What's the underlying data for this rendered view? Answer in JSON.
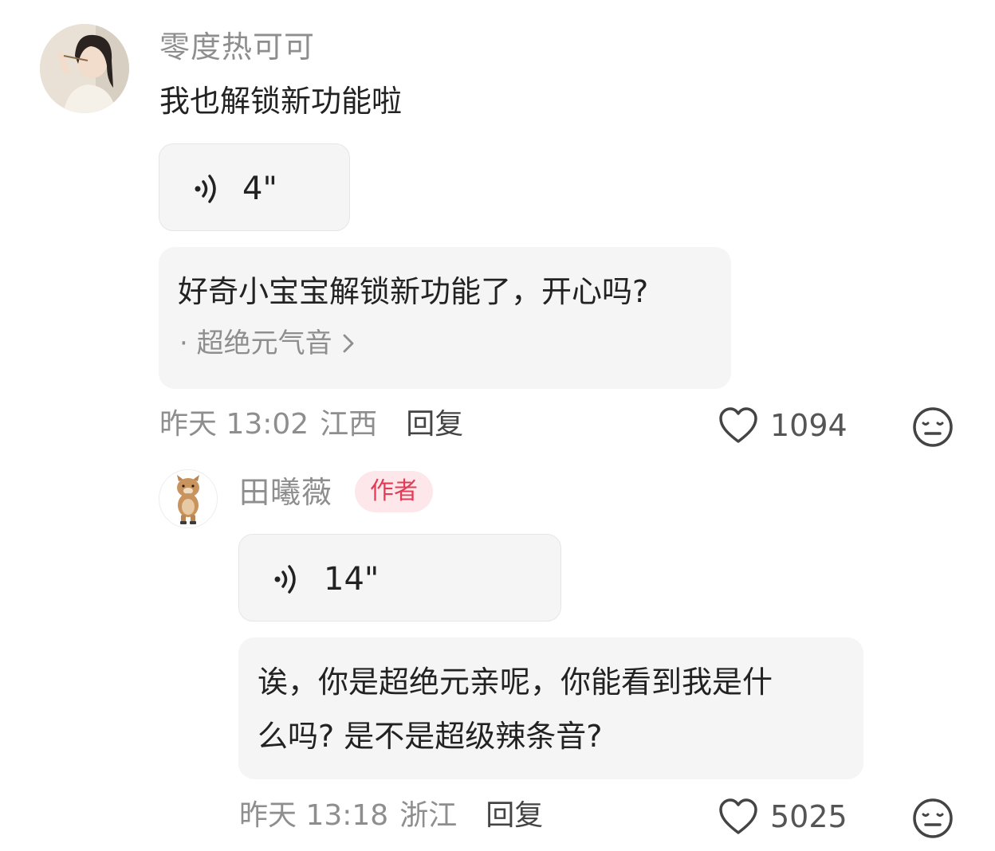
{
  "comment": {
    "username": "零度热可可",
    "text": "我也解锁新功能啦",
    "voice_duration": "4\"",
    "transcript": "好奇小宝宝解锁新功能了，开心吗?",
    "transcript_source": "· 超绝元气音",
    "time": "昨天 13:02",
    "location": "江西",
    "reply_label": "回复",
    "likes": "1094"
  },
  "reply": {
    "username": "田曦薇",
    "badge": "作者",
    "voice_duration": "14\"",
    "transcript_line1": "诶，你是超绝元亲呢，你能看到我是什",
    "transcript_line2": "么吗? 是不是超级辣条音?",
    "time": "昨天 13:18",
    "location": "浙江",
    "reply_label": "回复",
    "likes": "5025"
  },
  "icons": {
    "voice": "voice-wave-icon",
    "like": "heart-outline-icon",
    "dislike": "meh-face-icon",
    "chevron": "chevron-right-icon"
  },
  "colors": {
    "badge_bg": "#fde7ea",
    "badge_text": "#e23b55",
    "muted_text": "#8e8e8e"
  }
}
